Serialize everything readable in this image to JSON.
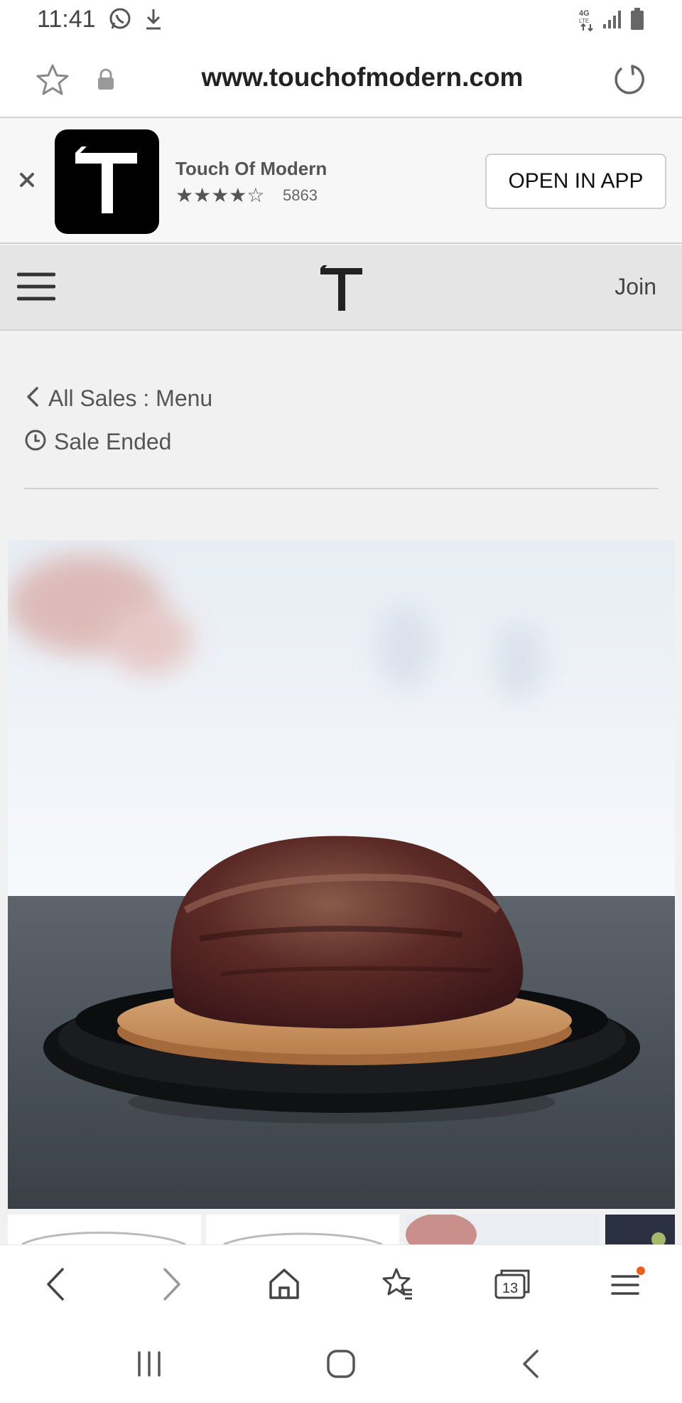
{
  "status_bar": {
    "time": "11:41",
    "icons": [
      "whatsapp-icon",
      "download-icon",
      "network-4g-lte-icon",
      "signal-icon",
      "battery-icon"
    ]
  },
  "browser": {
    "url": "www.touchofmodern.com",
    "tab_count": "13",
    "icons": [
      "bookmark-star-icon",
      "lock-icon",
      "reload-icon",
      "back-icon",
      "forward-icon",
      "home-icon",
      "bookmarks-icon",
      "tabs-icon",
      "menu-icon"
    ]
  },
  "app_banner": {
    "app_name": "Touch Of Modern",
    "rating_stars": "★★★★☆",
    "rating": 4.5,
    "rating_count": "5863",
    "open_button": "OPEN IN APP"
  },
  "site_header": {
    "join_label": "Join"
  },
  "breadcrumb": {
    "label": "All Sales : Menu"
  },
  "sale": {
    "status": "Sale Ended"
  },
  "colors": {
    "page_background": "#f1f1f1",
    "header_background": "#e5e5e5",
    "notification_dot": "#e8601c",
    "logo_black": "#000000"
  }
}
